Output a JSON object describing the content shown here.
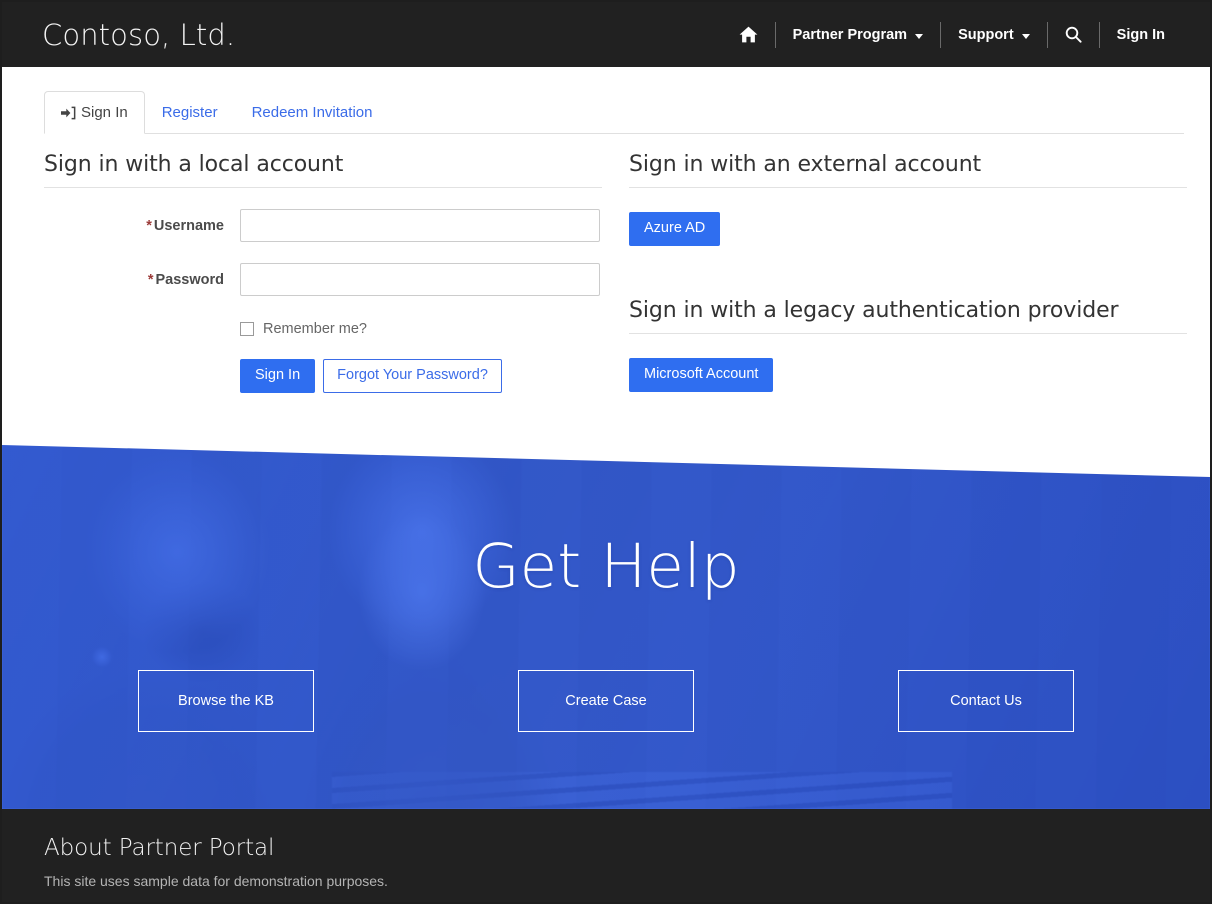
{
  "header": {
    "brand": "Contoso, Ltd.",
    "home_icon": "home-icon",
    "nav": [
      {
        "label": "Partner Program",
        "has_caret": true
      },
      {
        "label": "Support",
        "has_caret": true
      }
    ],
    "search_icon": "search-icon",
    "sign_in": "Sign In"
  },
  "tabs": [
    {
      "label": "Sign In",
      "icon": "sign-in-icon",
      "active": true
    },
    {
      "label": "Register",
      "icon": "",
      "active": false
    },
    {
      "label": "Redeem Invitation",
      "icon": "",
      "active": false
    }
  ],
  "local_account": {
    "heading": "Sign in with a local account",
    "username_label": "Username",
    "username_value": "",
    "username_placeholder": "",
    "password_label": "Password",
    "password_value": "",
    "password_placeholder": "",
    "required_marker": "*",
    "remember_label": "Remember me?",
    "remember_checked": false,
    "sign_in_button": "Sign In",
    "forgot_button": "Forgot Your Password?"
  },
  "external_account": {
    "heading": "Sign in with an external account",
    "providers": [
      {
        "label": "Azure AD"
      }
    ]
  },
  "legacy_account": {
    "heading": "Sign in with a legacy authentication provider",
    "providers": [
      {
        "label": "Microsoft Account"
      }
    ]
  },
  "hero": {
    "title": "Get Help",
    "buttons": [
      {
        "label": "Browse the KB"
      },
      {
        "label": "Create Case"
      },
      {
        "label": "Contact Us"
      }
    ]
  },
  "footer": {
    "title": "About Partner Portal",
    "text": "This site uses sample data for demonstration purposes."
  },
  "colors": {
    "header_bg": "#212121",
    "accent_blue": "#2f6ef0",
    "link_blue": "#3b6ce8",
    "hero_blue": "#3a69ef",
    "required_red": "#9b3a38",
    "footer_bg": "#212121"
  }
}
